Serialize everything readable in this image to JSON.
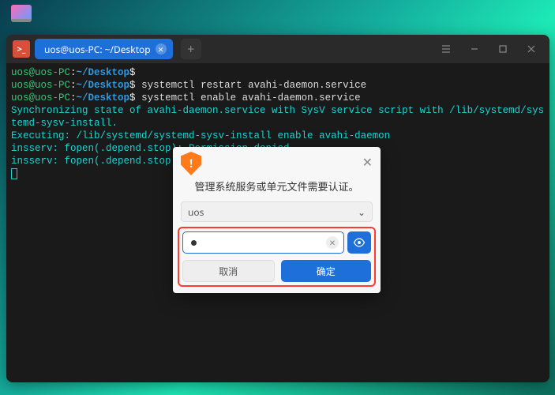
{
  "taskbar": {
    "app_icon": "monitor-icon"
  },
  "terminal": {
    "tab_title": "uos@uos-PC: ~/Desktop",
    "prompt_user": "uos@uos-PC",
    "prompt_sep": ":",
    "prompt_path": "~/Desktop",
    "prompt_sym": "$",
    "lines": {
      "cmd1": "",
      "cmd2": "systemctl restart avahi-daemon.service",
      "cmd3": "systemctl enable avahi-daemon.service",
      "out1": "Synchronizing state of avahi-daemon.service with SysV service script with /lib/systemd/systemd-sysv-install.",
      "out2": "Executing: /lib/systemd/systemd-sysv-install enable avahi-daemon",
      "out3": "insserv: fopen(.depend.stop): Permission denied",
      "out4": "insserv: fopen(.depend.stop): Permission denied"
    }
  },
  "dialog": {
    "title": "管理系统服务或单元文件需要认证。",
    "user": "uos",
    "password_masked": "●",
    "cancel": "取消",
    "ok": "确定"
  }
}
